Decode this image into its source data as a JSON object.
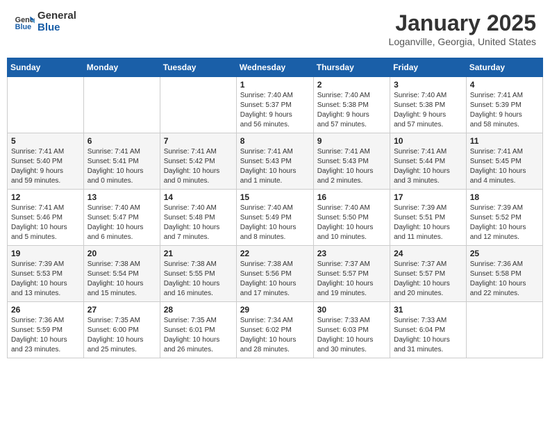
{
  "header": {
    "logo_line1": "General",
    "logo_line2": "Blue",
    "month": "January 2025",
    "location": "Loganville, Georgia, United States"
  },
  "weekdays": [
    "Sunday",
    "Monday",
    "Tuesday",
    "Wednesday",
    "Thursday",
    "Friday",
    "Saturday"
  ],
  "weeks": [
    [
      {
        "day": "",
        "info": ""
      },
      {
        "day": "",
        "info": ""
      },
      {
        "day": "",
        "info": ""
      },
      {
        "day": "1",
        "info": "Sunrise: 7:40 AM\nSunset: 5:37 PM\nDaylight: 9 hours\nand 56 minutes."
      },
      {
        "day": "2",
        "info": "Sunrise: 7:40 AM\nSunset: 5:38 PM\nDaylight: 9 hours\nand 57 minutes."
      },
      {
        "day": "3",
        "info": "Sunrise: 7:40 AM\nSunset: 5:38 PM\nDaylight: 9 hours\nand 57 minutes."
      },
      {
        "day": "4",
        "info": "Sunrise: 7:41 AM\nSunset: 5:39 PM\nDaylight: 9 hours\nand 58 minutes."
      }
    ],
    [
      {
        "day": "5",
        "info": "Sunrise: 7:41 AM\nSunset: 5:40 PM\nDaylight: 9 hours\nand 59 minutes."
      },
      {
        "day": "6",
        "info": "Sunrise: 7:41 AM\nSunset: 5:41 PM\nDaylight: 10 hours\nand 0 minutes."
      },
      {
        "day": "7",
        "info": "Sunrise: 7:41 AM\nSunset: 5:42 PM\nDaylight: 10 hours\nand 0 minutes."
      },
      {
        "day": "8",
        "info": "Sunrise: 7:41 AM\nSunset: 5:43 PM\nDaylight: 10 hours\nand 1 minute."
      },
      {
        "day": "9",
        "info": "Sunrise: 7:41 AM\nSunset: 5:43 PM\nDaylight: 10 hours\nand 2 minutes."
      },
      {
        "day": "10",
        "info": "Sunrise: 7:41 AM\nSunset: 5:44 PM\nDaylight: 10 hours\nand 3 minutes."
      },
      {
        "day": "11",
        "info": "Sunrise: 7:41 AM\nSunset: 5:45 PM\nDaylight: 10 hours\nand 4 minutes."
      }
    ],
    [
      {
        "day": "12",
        "info": "Sunrise: 7:41 AM\nSunset: 5:46 PM\nDaylight: 10 hours\nand 5 minutes."
      },
      {
        "day": "13",
        "info": "Sunrise: 7:40 AM\nSunset: 5:47 PM\nDaylight: 10 hours\nand 6 minutes."
      },
      {
        "day": "14",
        "info": "Sunrise: 7:40 AM\nSunset: 5:48 PM\nDaylight: 10 hours\nand 7 minutes."
      },
      {
        "day": "15",
        "info": "Sunrise: 7:40 AM\nSunset: 5:49 PM\nDaylight: 10 hours\nand 8 minutes."
      },
      {
        "day": "16",
        "info": "Sunrise: 7:40 AM\nSunset: 5:50 PM\nDaylight: 10 hours\nand 10 minutes."
      },
      {
        "day": "17",
        "info": "Sunrise: 7:39 AM\nSunset: 5:51 PM\nDaylight: 10 hours\nand 11 minutes."
      },
      {
        "day": "18",
        "info": "Sunrise: 7:39 AM\nSunset: 5:52 PM\nDaylight: 10 hours\nand 12 minutes."
      }
    ],
    [
      {
        "day": "19",
        "info": "Sunrise: 7:39 AM\nSunset: 5:53 PM\nDaylight: 10 hours\nand 13 minutes."
      },
      {
        "day": "20",
        "info": "Sunrise: 7:38 AM\nSunset: 5:54 PM\nDaylight: 10 hours\nand 15 minutes."
      },
      {
        "day": "21",
        "info": "Sunrise: 7:38 AM\nSunset: 5:55 PM\nDaylight: 10 hours\nand 16 minutes."
      },
      {
        "day": "22",
        "info": "Sunrise: 7:38 AM\nSunset: 5:56 PM\nDaylight: 10 hours\nand 17 minutes."
      },
      {
        "day": "23",
        "info": "Sunrise: 7:37 AM\nSunset: 5:57 PM\nDaylight: 10 hours\nand 19 minutes."
      },
      {
        "day": "24",
        "info": "Sunrise: 7:37 AM\nSunset: 5:57 PM\nDaylight: 10 hours\nand 20 minutes."
      },
      {
        "day": "25",
        "info": "Sunrise: 7:36 AM\nSunset: 5:58 PM\nDaylight: 10 hours\nand 22 minutes."
      }
    ],
    [
      {
        "day": "26",
        "info": "Sunrise: 7:36 AM\nSunset: 5:59 PM\nDaylight: 10 hours\nand 23 minutes."
      },
      {
        "day": "27",
        "info": "Sunrise: 7:35 AM\nSunset: 6:00 PM\nDaylight: 10 hours\nand 25 minutes."
      },
      {
        "day": "28",
        "info": "Sunrise: 7:35 AM\nSunset: 6:01 PM\nDaylight: 10 hours\nand 26 minutes."
      },
      {
        "day": "29",
        "info": "Sunrise: 7:34 AM\nSunset: 6:02 PM\nDaylight: 10 hours\nand 28 minutes."
      },
      {
        "day": "30",
        "info": "Sunrise: 7:33 AM\nSunset: 6:03 PM\nDaylight: 10 hours\nand 30 minutes."
      },
      {
        "day": "31",
        "info": "Sunrise: 7:33 AM\nSunset: 6:04 PM\nDaylight: 10 hours\nand 31 minutes."
      },
      {
        "day": "",
        "info": ""
      }
    ]
  ]
}
